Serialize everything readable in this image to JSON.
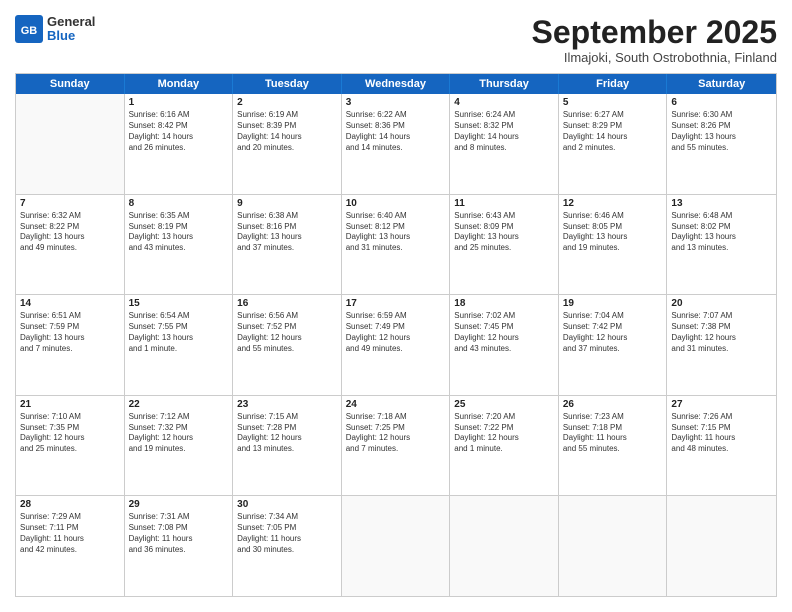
{
  "logo": {
    "general": "General",
    "blue": "Blue"
  },
  "header": {
    "month": "September 2025",
    "location": "Ilmajoki, South Ostrobothnia, Finland"
  },
  "days": [
    "Sunday",
    "Monday",
    "Tuesday",
    "Wednesday",
    "Thursday",
    "Friday",
    "Saturday"
  ],
  "weeks": [
    [
      {
        "day": "",
        "data": []
      },
      {
        "day": "1",
        "data": [
          "Sunrise: 6:16 AM",
          "Sunset: 8:42 PM",
          "Daylight: 14 hours",
          "and 26 minutes."
        ]
      },
      {
        "day": "2",
        "data": [
          "Sunrise: 6:19 AM",
          "Sunset: 8:39 PM",
          "Daylight: 14 hours",
          "and 20 minutes."
        ]
      },
      {
        "day": "3",
        "data": [
          "Sunrise: 6:22 AM",
          "Sunset: 8:36 PM",
          "Daylight: 14 hours",
          "and 14 minutes."
        ]
      },
      {
        "day": "4",
        "data": [
          "Sunrise: 6:24 AM",
          "Sunset: 8:32 PM",
          "Daylight: 14 hours",
          "and 8 minutes."
        ]
      },
      {
        "day": "5",
        "data": [
          "Sunrise: 6:27 AM",
          "Sunset: 8:29 PM",
          "Daylight: 14 hours",
          "and 2 minutes."
        ]
      },
      {
        "day": "6",
        "data": [
          "Sunrise: 6:30 AM",
          "Sunset: 8:26 PM",
          "Daylight: 13 hours",
          "and 55 minutes."
        ]
      }
    ],
    [
      {
        "day": "7",
        "data": [
          "Sunrise: 6:32 AM",
          "Sunset: 8:22 PM",
          "Daylight: 13 hours",
          "and 49 minutes."
        ]
      },
      {
        "day": "8",
        "data": [
          "Sunrise: 6:35 AM",
          "Sunset: 8:19 PM",
          "Daylight: 13 hours",
          "and 43 minutes."
        ]
      },
      {
        "day": "9",
        "data": [
          "Sunrise: 6:38 AM",
          "Sunset: 8:16 PM",
          "Daylight: 13 hours",
          "and 37 minutes."
        ]
      },
      {
        "day": "10",
        "data": [
          "Sunrise: 6:40 AM",
          "Sunset: 8:12 PM",
          "Daylight: 13 hours",
          "and 31 minutes."
        ]
      },
      {
        "day": "11",
        "data": [
          "Sunrise: 6:43 AM",
          "Sunset: 8:09 PM",
          "Daylight: 13 hours",
          "and 25 minutes."
        ]
      },
      {
        "day": "12",
        "data": [
          "Sunrise: 6:46 AM",
          "Sunset: 8:05 PM",
          "Daylight: 13 hours",
          "and 19 minutes."
        ]
      },
      {
        "day": "13",
        "data": [
          "Sunrise: 6:48 AM",
          "Sunset: 8:02 PM",
          "Daylight: 13 hours",
          "and 13 minutes."
        ]
      }
    ],
    [
      {
        "day": "14",
        "data": [
          "Sunrise: 6:51 AM",
          "Sunset: 7:59 PM",
          "Daylight: 13 hours",
          "and 7 minutes."
        ]
      },
      {
        "day": "15",
        "data": [
          "Sunrise: 6:54 AM",
          "Sunset: 7:55 PM",
          "Daylight: 13 hours",
          "and 1 minute."
        ]
      },
      {
        "day": "16",
        "data": [
          "Sunrise: 6:56 AM",
          "Sunset: 7:52 PM",
          "Daylight: 12 hours",
          "and 55 minutes."
        ]
      },
      {
        "day": "17",
        "data": [
          "Sunrise: 6:59 AM",
          "Sunset: 7:49 PM",
          "Daylight: 12 hours",
          "and 49 minutes."
        ]
      },
      {
        "day": "18",
        "data": [
          "Sunrise: 7:02 AM",
          "Sunset: 7:45 PM",
          "Daylight: 12 hours",
          "and 43 minutes."
        ]
      },
      {
        "day": "19",
        "data": [
          "Sunrise: 7:04 AM",
          "Sunset: 7:42 PM",
          "Daylight: 12 hours",
          "and 37 minutes."
        ]
      },
      {
        "day": "20",
        "data": [
          "Sunrise: 7:07 AM",
          "Sunset: 7:38 PM",
          "Daylight: 12 hours",
          "and 31 minutes."
        ]
      }
    ],
    [
      {
        "day": "21",
        "data": [
          "Sunrise: 7:10 AM",
          "Sunset: 7:35 PM",
          "Daylight: 12 hours",
          "and 25 minutes."
        ]
      },
      {
        "day": "22",
        "data": [
          "Sunrise: 7:12 AM",
          "Sunset: 7:32 PM",
          "Daylight: 12 hours",
          "and 19 minutes."
        ]
      },
      {
        "day": "23",
        "data": [
          "Sunrise: 7:15 AM",
          "Sunset: 7:28 PM",
          "Daylight: 12 hours",
          "and 13 minutes."
        ]
      },
      {
        "day": "24",
        "data": [
          "Sunrise: 7:18 AM",
          "Sunset: 7:25 PM",
          "Daylight: 12 hours",
          "and 7 minutes."
        ]
      },
      {
        "day": "25",
        "data": [
          "Sunrise: 7:20 AM",
          "Sunset: 7:22 PM",
          "Daylight: 12 hours",
          "and 1 minute."
        ]
      },
      {
        "day": "26",
        "data": [
          "Sunrise: 7:23 AM",
          "Sunset: 7:18 PM",
          "Daylight: 11 hours",
          "and 55 minutes."
        ]
      },
      {
        "day": "27",
        "data": [
          "Sunrise: 7:26 AM",
          "Sunset: 7:15 PM",
          "Daylight: 11 hours",
          "and 48 minutes."
        ]
      }
    ],
    [
      {
        "day": "28",
        "data": [
          "Sunrise: 7:29 AM",
          "Sunset: 7:11 PM",
          "Daylight: 11 hours",
          "and 42 minutes."
        ]
      },
      {
        "day": "29",
        "data": [
          "Sunrise: 7:31 AM",
          "Sunset: 7:08 PM",
          "Daylight: 11 hours",
          "and 36 minutes."
        ]
      },
      {
        "day": "30",
        "data": [
          "Sunrise: 7:34 AM",
          "Sunset: 7:05 PM",
          "Daylight: 11 hours",
          "and 30 minutes."
        ]
      },
      {
        "day": "",
        "data": []
      },
      {
        "day": "",
        "data": []
      },
      {
        "day": "",
        "data": []
      },
      {
        "day": "",
        "data": []
      }
    ]
  ]
}
